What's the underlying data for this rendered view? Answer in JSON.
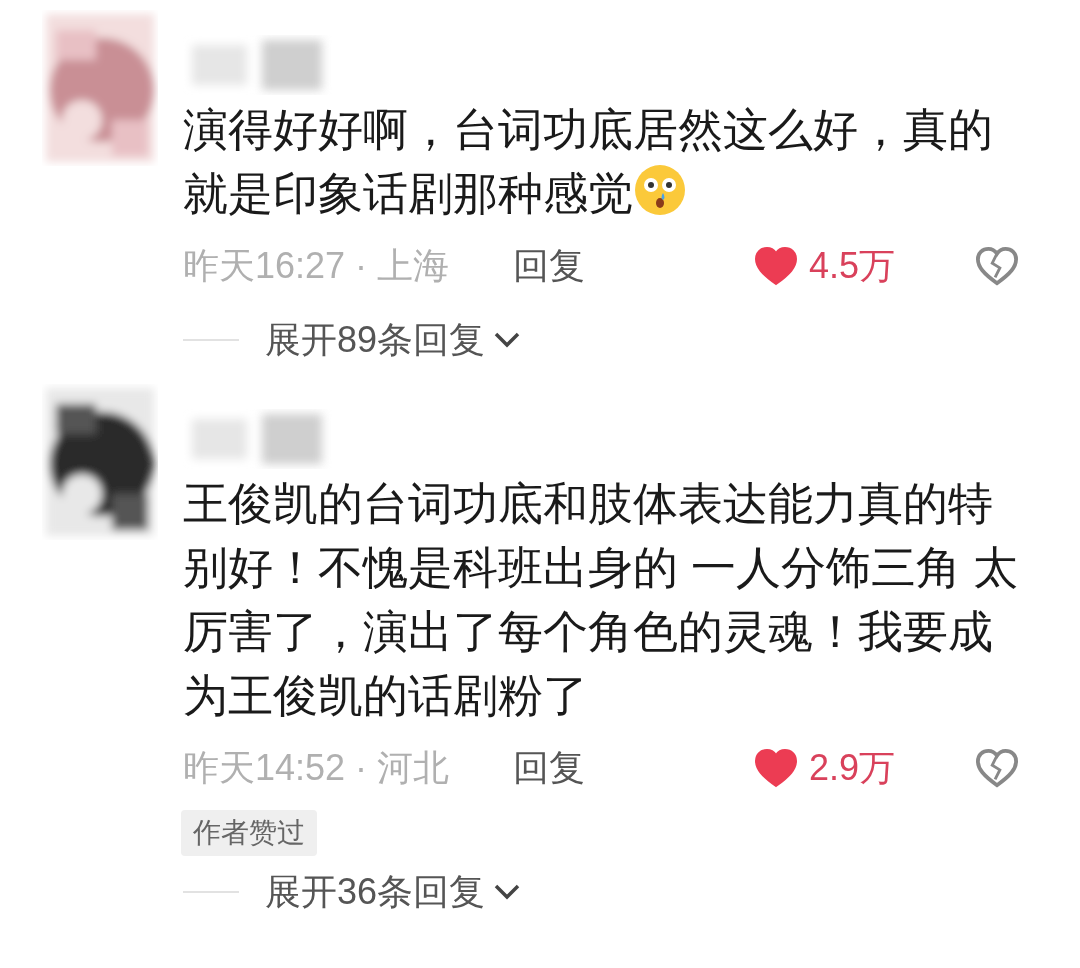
{
  "comments": [
    {
      "text": "演得好好啊，台词功底居然这么好，真的就是印象话剧那种感觉",
      "has_emoji": true,
      "time": "昨天16:27 · 上海",
      "reply": "回复",
      "liked": true,
      "like_count": "4.5万",
      "expand": "展开89条回复"
    },
    {
      "text": "王俊凯的台词功底和肢体表达能力真的特别好！不愧是科班出身的 一人分饰三角 太厉害了，演出了每个角色的灵魂！我要成为王俊凯的话剧粉了",
      "has_emoji": false,
      "time": "昨天14:52 · 河北",
      "reply": "回复",
      "liked": true,
      "like_count": "2.9万",
      "badge": "作者赞过",
      "expand": "展开36条回复"
    }
  ]
}
